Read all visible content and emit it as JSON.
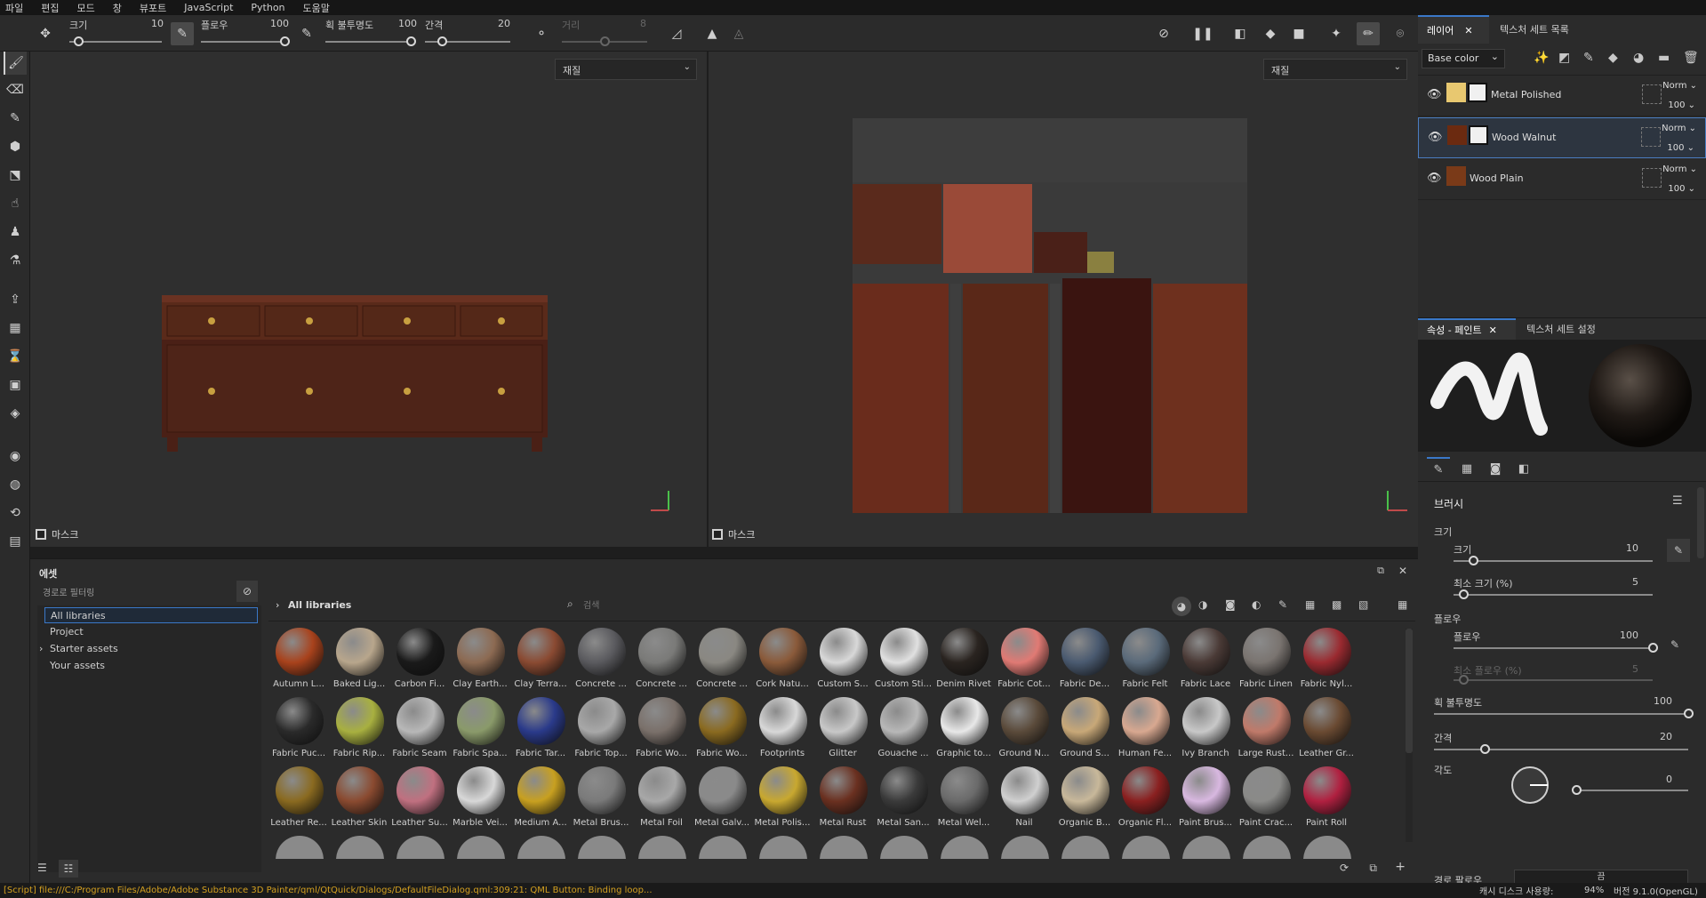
{
  "menu": [
    "파일",
    "편집",
    "모드",
    "창",
    "뷰포트",
    "JavaScript",
    "Python",
    "도움말"
  ],
  "toolbar": {
    "size_label": "크기",
    "size_value": "10",
    "size_level": 0.1,
    "flow_label": "플로우",
    "flow_value": "100",
    "flow_level": 1.0,
    "opacity_label": "획 불투명도",
    "opacity_value": "100",
    "opacity_level": 1.0,
    "spacing_label": "간격",
    "spacing_value": "20",
    "spacing_level": 0.2,
    "distance_label": "거리",
    "distance_value": "8",
    "distance_level": 0.5
  },
  "viewports": {
    "left_select": "재질",
    "right_select": "재질",
    "mask_label": "마스크"
  },
  "layers_panel": {
    "tabs": [
      "레이어",
      "텍스처 세트 목록"
    ],
    "channel_select": "Base color",
    "layers": [
      {
        "name": "Metal Polished",
        "blend": "Norm",
        "opacity": "100",
        "color": "#e8c870"
      },
      {
        "name": "Wood Walnut",
        "blend": "Norm",
        "opacity": "100",
        "color": "#6b2a10"
      },
      {
        "name": "Wood Plain",
        "blend": "Norm",
        "opacity": "100",
        "color": "#7a3a18"
      }
    ]
  },
  "properties": {
    "tabs": [
      "속성 - 페인트",
      "텍스처 세트 설정"
    ],
    "section_brush": "브러시",
    "size_label": "크기",
    "size_sub": "크기",
    "size_value": "10",
    "size_level": 0.1,
    "min_size_label": "최소 크기 (%)",
    "min_size_value": "5",
    "min_size_level": 0.05,
    "flow_label": "플로우",
    "flow_sub": "플로우",
    "flow_value": "100",
    "flow_level": 1.0,
    "min_flow_label": "최소 플로우 (%)",
    "min_flow_value": "5",
    "min_flow_level": 0.05,
    "stroke_opacity_label": "획 불투명도",
    "stroke_opacity_value": "100",
    "stroke_opacity_level": 1.0,
    "spacing_label": "간격",
    "spacing_value": "20",
    "spacing_level": 0.2,
    "angle_label": "각도",
    "angle_value": "0",
    "angle_level": 0.0,
    "bottom_label": "경로 팔로우",
    "bottom_value": "끔"
  },
  "assets": {
    "title": "에셋",
    "filter_label": "경로로 필터링",
    "tree": [
      "All libraries",
      "Project",
      "Starter assets",
      "Your assets"
    ],
    "breadcrumb": "All libraries",
    "search_placeholder": "검색",
    "materials": [
      {
        "label": "Autumn L...",
        "color": "#a8421c"
      },
      {
        "label": "Baked Lig...",
        "color": "#b8a68c"
      },
      {
        "label": "Carbon Fi...",
        "color": "#1a1a1a"
      },
      {
        "label": "Clay Earth...",
        "color": "#8c6a52"
      },
      {
        "label": "Clay Terra...",
        "color": "#8a4a32"
      },
      {
        "label": "Concrete ...",
        "color": "#5a5a5e"
      },
      {
        "label": "Concrete ...",
        "color": "#7a7a78"
      },
      {
        "label": "Concrete ...",
        "color": "#8a8882"
      },
      {
        "label": "Cork Natu...",
        "color": "#8a5a3a"
      },
      {
        "label": "Custom S...",
        "color": "#d8d8d8"
      },
      {
        "label": "Custom Sti...",
        "color": "#e0e0e0"
      },
      {
        "label": "Denim Rivet",
        "color": "#2a2420"
      },
      {
        "label": "Fabric Cot...",
        "color": "#e07a74"
      },
      {
        "label": "Fabric De...",
        "color": "#4a5a70"
      },
      {
        "label": "Fabric Felt",
        "color": "#5a6a7a"
      },
      {
        "label": "Fabric Lace",
        "color": "#4a3a36"
      },
      {
        "label": "Fabric Linen",
        "color": "#7a7470"
      },
      {
        "label": "Fabric Nyl...",
        "color": "#9a2a30"
      },
      {
        "label": "Fabric Puc...",
        "color": "#2a2a2a"
      },
      {
        "label": "Fabric Rip...",
        "color": "#a8b040"
      },
      {
        "label": "Fabric Seam",
        "color": "#b8b8b8"
      },
      {
        "label": "Fabric Spa...",
        "color": "#8a9a6a"
      },
      {
        "label": "Fabric Tar...",
        "color": "#2a3a8a"
      },
      {
        "label": "Fabric Top...",
        "color": "#a8a8a8"
      },
      {
        "label": "Fabric Wo...",
        "color": "#7a706a"
      },
      {
        "label": "Fabric Wo...",
        "color": "#8a6a20"
      },
      {
        "label": "Footprints",
        "color": "#d8d8d8"
      },
      {
        "label": "Glitter",
        "color": "#c8c8c8"
      },
      {
        "label": "Gouache ...",
        "color": "#b8b8b8"
      },
      {
        "label": "Graphic to...",
        "color": "#e8e8e8"
      },
      {
        "label": "Ground N...",
        "color": "#5a4a3a"
      },
      {
        "label": "Ground S...",
        "color": "#c8a878"
      },
      {
        "label": "Human Fe...",
        "color": "#d8a890"
      },
      {
        "label": "Ivy Branch",
        "color": "#c8c8c8"
      },
      {
        "label": "Large Rust...",
        "color": "#c07a6a"
      },
      {
        "label": "Leather Gr...",
        "color": "#6a4a32"
      },
      {
        "label": "Leather Re...",
        "color": "#8a6a20"
      },
      {
        "label": "Leather Skin",
        "color": "#8a4a30"
      },
      {
        "label": "Leather Su...",
        "color": "#c07080"
      },
      {
        "label": "Marble Vei...",
        "color": "#d8d8d8"
      },
      {
        "label": "Medium A...",
        "color": "#c8a020"
      },
      {
        "label": "Metal Brus...",
        "color": "#7a7a7a"
      },
      {
        "label": "Metal Foil",
        "color": "#a8a8a8"
      },
      {
        "label": "Metal Galv...",
        "color": "#8a8a8a"
      },
      {
        "label": "Metal Polis...",
        "color": "#c8a830"
      },
      {
        "label": "Metal Rust",
        "color": "#6a3020"
      },
      {
        "label": "Metal San...",
        "color": "#3a3a3a"
      },
      {
        "label": "Metal Wel...",
        "color": "#6a6a6a"
      },
      {
        "label": "Nail",
        "color": "#d0d0d0"
      },
      {
        "label": "Organic B...",
        "color": "#c8b89a"
      },
      {
        "label": "Organic Fl...",
        "color": "#8a2020"
      },
      {
        "label": "Paint Brus...",
        "color": "#d8b8e0"
      },
      {
        "label": "Paint Crac...",
        "color": "#8a8a88"
      },
      {
        "label": "Paint Roll",
        "color": "#b02040"
      }
    ]
  },
  "status": {
    "message": "[Script] file:///C:/Program Files/Adobe/Adobe Substance 3D Painter/qml/QtQuick/Dialogs/DefaultFileDialog.qml:309:21: QML Button: Binding loop...",
    "cache": "캐시 디스크 사용량:",
    "cache_value": "94%",
    "version": "버전 9.1.0(OpenGL)"
  },
  "colors": {
    "accent": "#3a78c8",
    "status_text": "#d4a020"
  }
}
